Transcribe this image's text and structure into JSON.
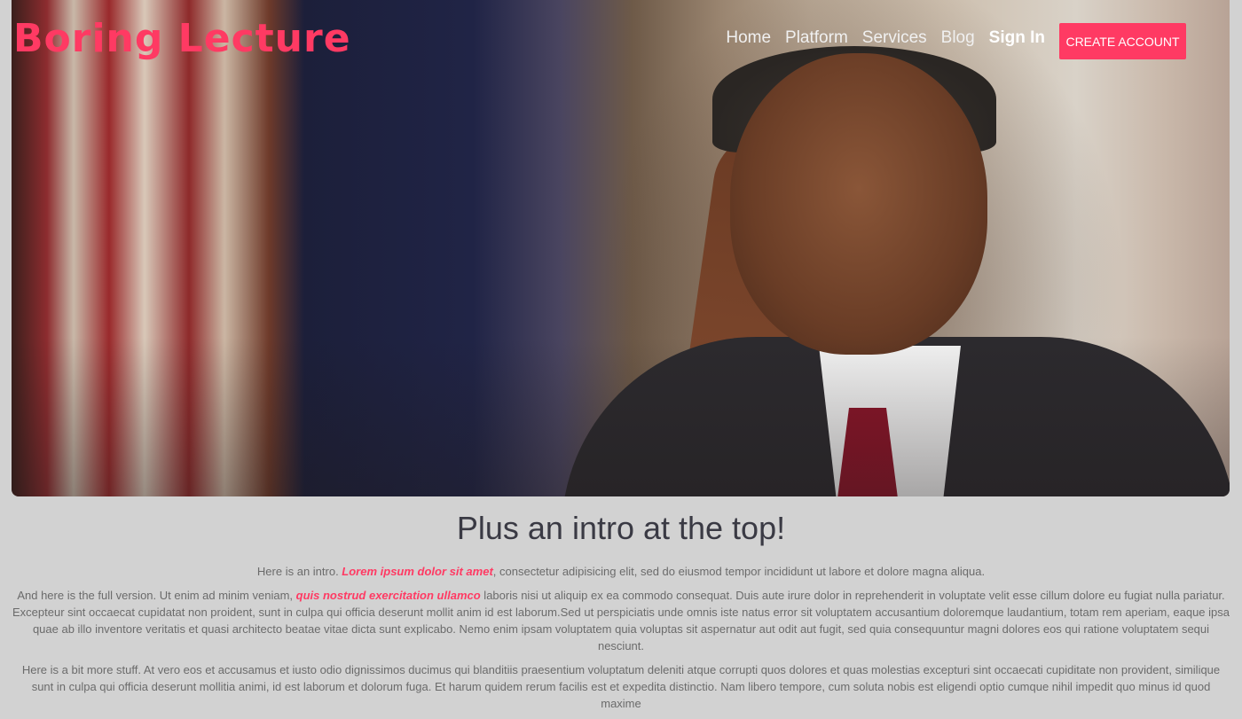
{
  "brand": {
    "logo_text": "Boring Lecture",
    "accent_color": "#ff3a63"
  },
  "nav": {
    "items": [
      {
        "label": "Home"
      },
      {
        "label": "Platform"
      },
      {
        "label": "Services"
      },
      {
        "label": "Blog"
      },
      {
        "label": "Sign In"
      }
    ],
    "cta_label": "CREATE ACCOUNT"
  },
  "hero": {
    "image_alt": "Man resting head on hand in front of flags"
  },
  "intro": {
    "heading": "Plus an intro at the top!",
    "p1_prefix": "Here is an intro. ",
    "p1_highlight": "Lorem ipsum dolor sit amet",
    "p1_suffix": ", consectetur adipisicing elit, sed do eiusmod tempor incididunt ut labore et dolore magna aliqua.",
    "p2_prefix": "And here is the full version. Ut enim ad minim veniam, ",
    "p2_highlight": "quis nostrud exercitation ullamco",
    "p2_suffix": " laboris nisi ut aliquip ex ea commodo consequat. Duis aute irure dolor in reprehenderit in voluptate velit esse cillum dolore eu fugiat nulla pariatur. Excepteur sint occaecat cupidatat non proident, sunt in culpa qui officia deserunt mollit anim id est laborum.Sed ut perspiciatis unde omnis iste natus error sit voluptatem accusantium doloremque laudantium, totam rem aperiam, eaque ipsa quae ab illo inventore veritatis et quasi architecto beatae vitae dicta sunt explicabo. Nemo enim ipsam voluptatem quia voluptas sit aspernatur aut odit aut fugit, sed quia consequuntur magni dolores eos qui ratione voluptatem sequi nesciunt.",
    "p3": "Here is a bit more stuff. At vero eos et accusamus et iusto odio dignissimos ducimus qui blanditiis praesentium voluptatum deleniti atque corrupti quos dolores et quas molestias excepturi sint occaecati cupiditate non provident, similique sunt in culpa qui officia deserunt mollitia animi, id est laborum et dolorum fuga. Et harum quidem rerum facilis est et expedita distinctio. Nam libero tempore, cum soluta nobis est eligendi optio cumque nihil impedit quo minus id quod maxime"
  }
}
